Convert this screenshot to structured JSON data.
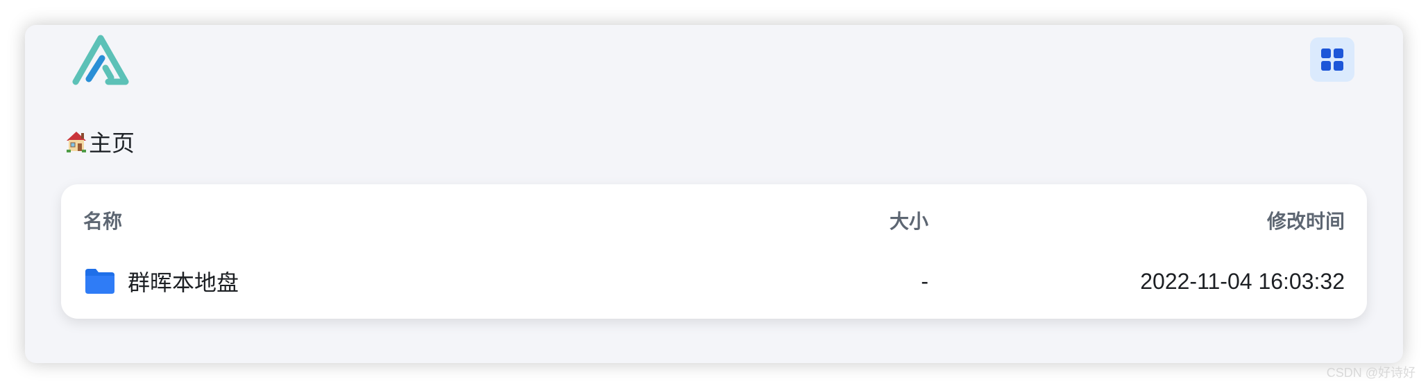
{
  "breadcrumb": {
    "label": "主页"
  },
  "table": {
    "headers": {
      "name": "名称",
      "size": "大小",
      "modified": "修改时间"
    },
    "rows": [
      {
        "name": "群晖本地盘",
        "size": "-",
        "modified": "2022-11-04 16:03:32",
        "icon": "folder-icon"
      }
    ]
  },
  "watermark": "CSDN @好诗好",
  "colors": {
    "accent": "#1d56d8",
    "folder": "#2f7cf6",
    "logo_teal": "#5cc1b7",
    "logo_blue": "#2a8fd6",
    "toggle_bg": "#dbeafd",
    "window_bg": "#f4f5f9"
  },
  "icons": {
    "logo": "alist-logo",
    "layout_toggle": "grid-view-icon",
    "breadcrumb": "house-icon"
  }
}
